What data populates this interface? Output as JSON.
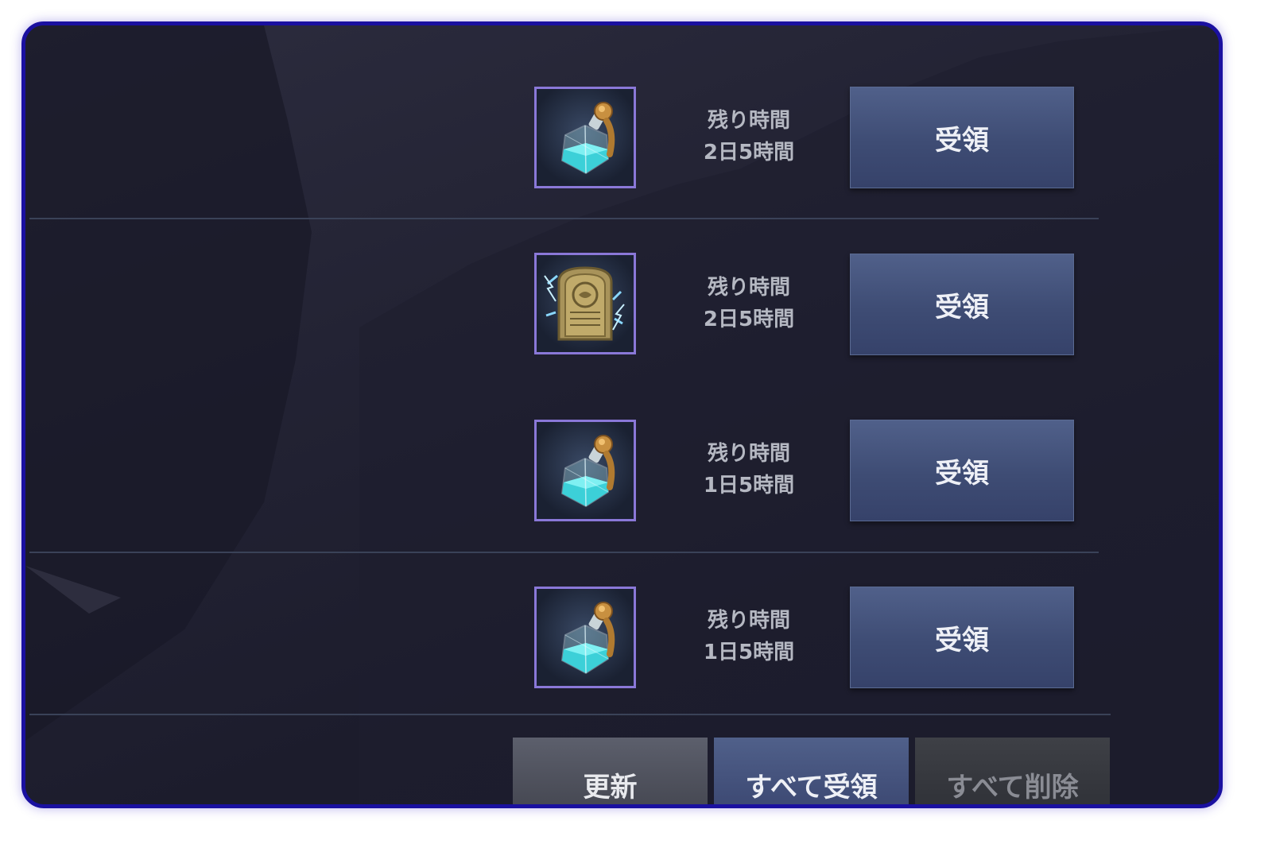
{
  "rewards": [
    {
      "item_icon": "potion-bottle-icon",
      "time_label": "残り時間",
      "time_value": "2日5時間",
      "claim_label": "受領"
    },
    {
      "item_icon": "golden-tablet-icon",
      "time_label": "残り時間",
      "time_value": "2日5時間",
      "claim_label": "受領"
    },
    {
      "item_icon": "potion-bottle-icon",
      "time_label": "残り時間",
      "time_value": "1日5時間",
      "claim_label": "受領"
    },
    {
      "item_icon": "potion-bottle-icon",
      "time_label": "残り時間",
      "time_value": "1日5時間",
      "claim_label": "受領"
    }
  ],
  "footer": {
    "refresh_label": "更新",
    "claim_all_label": "すべて受領",
    "delete_all_label": "すべて削除"
  },
  "colors": {
    "frame_border": "#1a10a0",
    "panel_bg": "#232334",
    "claim_button": "#44527a",
    "item_frame_border": "#8a78d8",
    "time_text": "#b5b8c2"
  }
}
